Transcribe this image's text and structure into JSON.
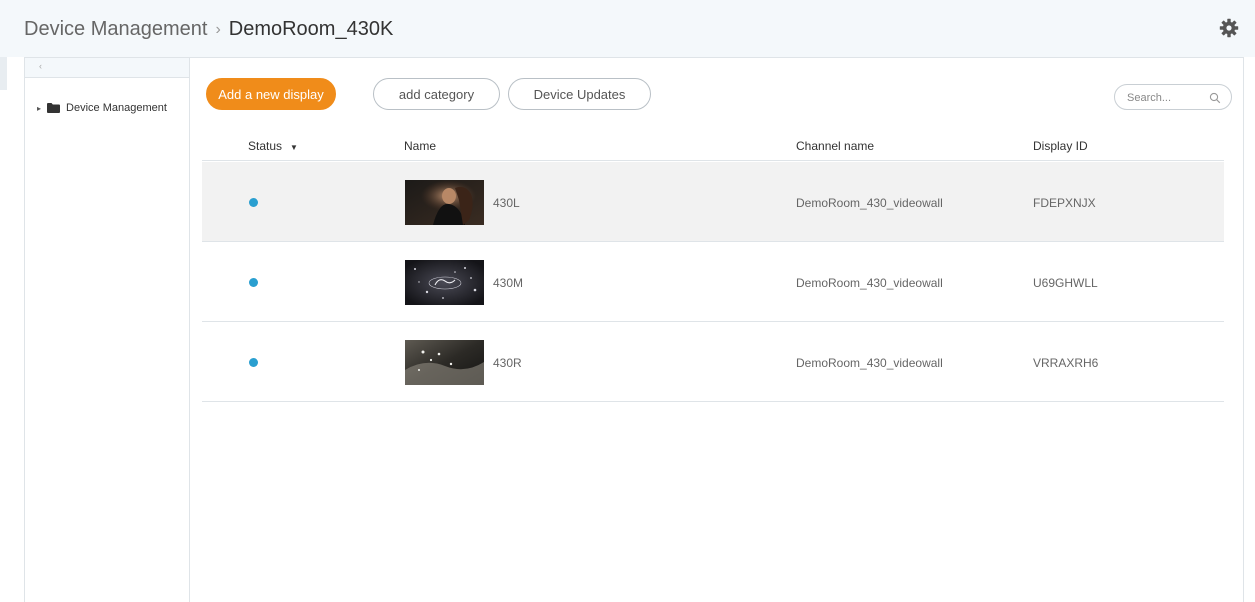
{
  "breadcrumb": {
    "root": "Device Management",
    "separator": "›",
    "current": "DemoRoom_430K"
  },
  "sidebar": {
    "collapse_label": "‹",
    "tree": [
      {
        "label": "Device Management",
        "icon": "folder-icon"
      }
    ]
  },
  "toolbar": {
    "add_display_label": "Add a new display",
    "add_category_label": "add category",
    "device_updates_label": "Device Updates",
    "search_placeholder": "Search..."
  },
  "table": {
    "columns": {
      "status": "Status",
      "name": "Name",
      "channel": "Channel name",
      "display_id": "Display ID"
    },
    "rows": [
      {
        "status": "online",
        "name": "430L",
        "channel": "DemoRoom_430_videowall",
        "display_id": "FDEPXNJX",
        "selected": true
      },
      {
        "status": "online",
        "name": "430M",
        "channel": "DemoRoom_430_videowall",
        "display_id": "U69GHWLL",
        "selected": false
      },
      {
        "status": "online",
        "name": "430R",
        "channel": "DemoRoom_430_videowall",
        "display_id": "VRRAXRH6",
        "selected": false
      }
    ]
  },
  "colors": {
    "accent": "#f08c1a",
    "status_online": "#2a9fd0",
    "header_bg": "#f4f8fb"
  },
  "icons": [
    "gear-icon",
    "folder-icon",
    "caret-right-icon",
    "sort-down-icon",
    "search-icon"
  ]
}
